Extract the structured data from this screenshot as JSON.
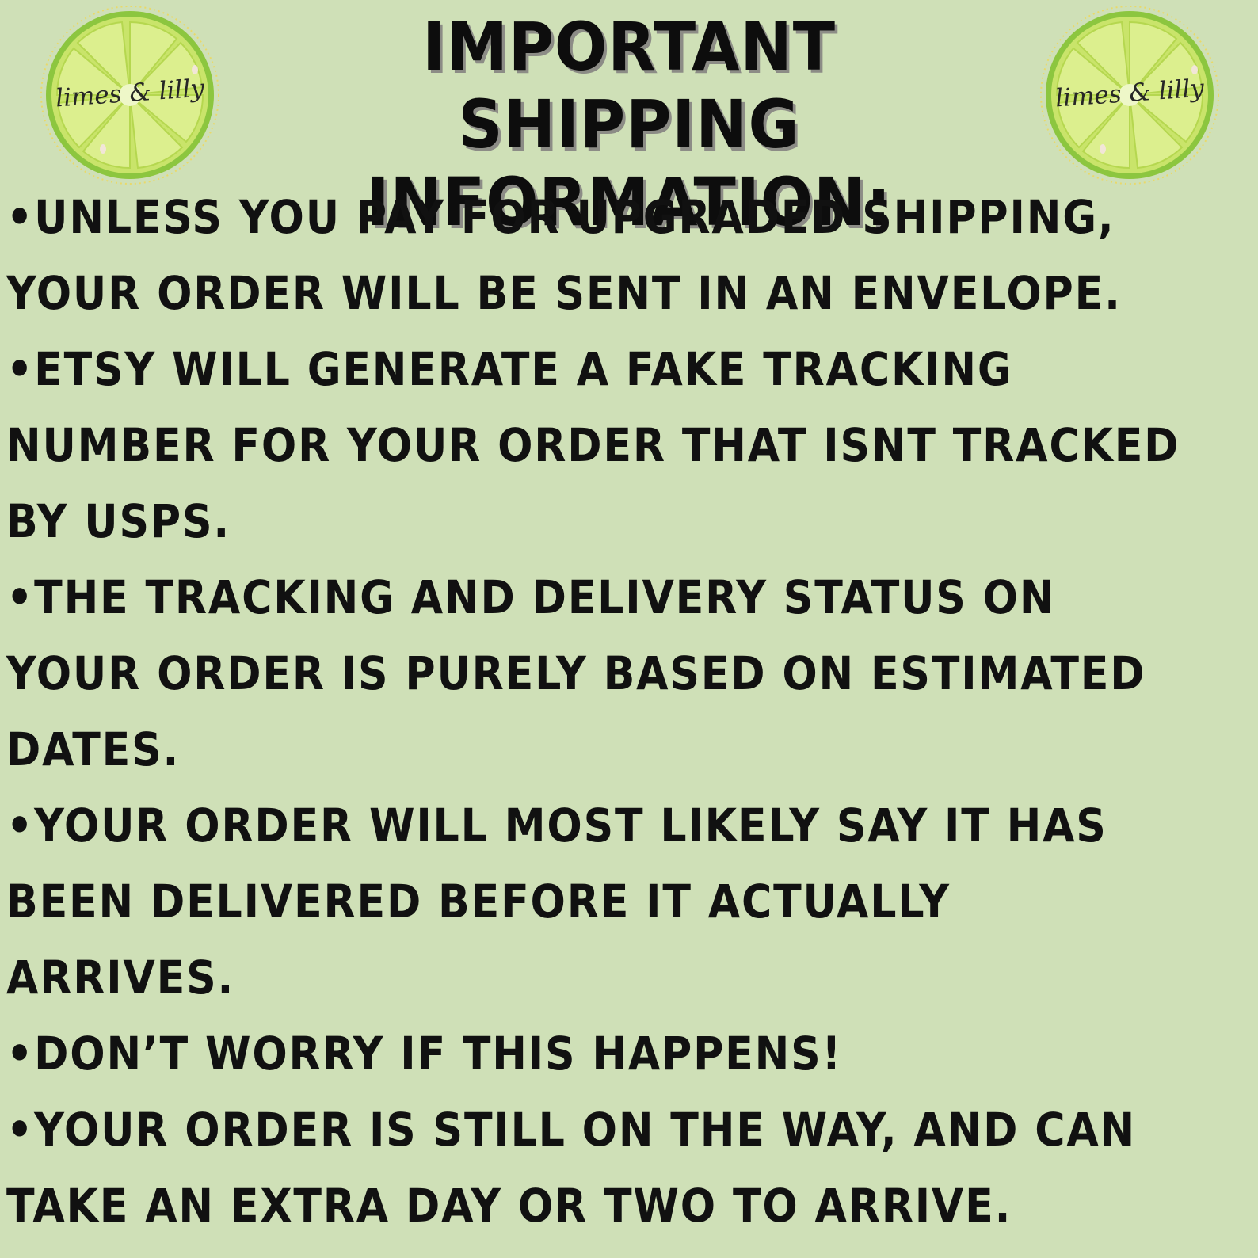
{
  "header": {
    "title_line1": "IMPORTANT SHIPPING",
    "title_line2": "INFORMATION:",
    "logo_text": "limes & lilly",
    "logo_icon": "lime-slice-icon"
  },
  "colors": {
    "background": "#cfe0b7",
    "text": "#111111",
    "lime_light": "#d8ec8a",
    "lime_dark": "#8cc63f"
  },
  "lines": [
    "•UNLESS YOU PAY FOR UPGRADED SHIPPING,",
    "YOUR ORDER WILL BE SENT IN AN ENVELOPE.",
    "•ETSY WILL GENERATE A FAKE TRACKING",
    "NUMBER FOR YOUR ORDER THAT ISNT TRACKED",
    "BY USPS.",
    "•THE TRACKING AND DELIVERY STATUS ON",
    "YOUR ORDER IS PURELY BASED ON ESTIMATED",
    "DATES.",
    "•YOUR ORDER WILL MOST LIKELY SAY IT HAS",
    "BEEN DELIVERED BEFORE IT ACTUALLY",
    "ARRIVES.",
    "•DON’T WORRY IF THIS HAPPENS!",
    "•YOUR ORDER IS STILL ON THE WAY, AND CAN",
    "TAKE AN EXTRA DAY OR TWO TO ARRIVE."
  ]
}
